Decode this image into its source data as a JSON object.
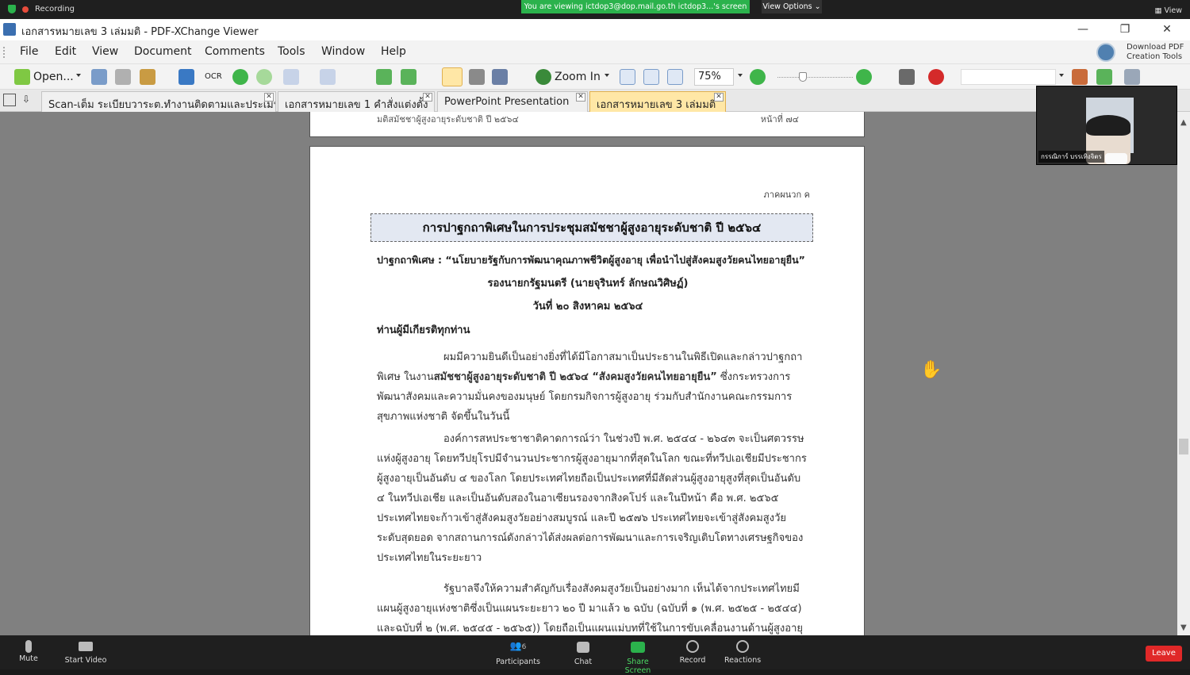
{
  "zoom": {
    "recording_label": "Recording",
    "viewing_banner": "You are viewing ictdop3@dop.mail.go.th ictdop3...'s screen",
    "view_options": "View Options ⌄",
    "view_right": "▦ View",
    "bottom": {
      "mute": "Mute",
      "start_video": "Start Video",
      "participants": "Participants",
      "participants_count": "6",
      "chat": "Chat",
      "share_screen": "Share Screen",
      "record": "Record",
      "reactions": "Reactions",
      "leave": "Leave"
    },
    "video_name": "กรรณิการ์ บรรเทิงจิตร",
    "colors": {
      "share_green": "#2bb24c",
      "leave_red": "#e02828"
    }
  },
  "window": {
    "title": "เอกสารหมายเลข 3 เล่มมติ - PDF-XChange Viewer",
    "menu": [
      "File",
      "Edit",
      "View",
      "Document",
      "Comments",
      "Tools",
      "Window",
      "Help"
    ],
    "download_line1": "Download PDF",
    "download_line2": "Creation Tools",
    "toolbar": {
      "open": "Open...",
      "zoom_in": "Zoom In",
      "zoom_value": "75%",
      "ocr": "OCR"
    },
    "tabs": [
      "Scan-เต็ม ระเบียบวาระต.ทำงานติดตามและประเมิน",
      "เอกสารหมายเลข 1 คำสั่งแต่งตั้ง",
      "PowerPoint Presentation",
      "เอกสารหมายเลข 3 เล่มมติ"
    ]
  },
  "document": {
    "prev_header_left": "มติสมัชชาผู้สูงอายุระดับชาติ ปี ๒๕๖๔",
    "prev_header_right": "หน้าที่ ๗๔",
    "appendix": "ภาคผนวก ค",
    "heading": "การปาฐกถาพิเศษในการประชุมสมัชชาผู้สูงอายุระดับชาติ ปี ๒๕๖๔",
    "speech_title": "ปาฐกถาพิเศษ : “นโยบายรัฐกับการพัฒนาคุณภาพชีวิตผู้สูงอายุ เพื่อนำไปสู่สังคมสูงวัยคนไทยอายุยืน”",
    "speaker": "รองนายกรัฐมนตรี (นายจุรินทร์ ลักษณวิศิษฏ์)",
    "date": "วันที่ ๒๐ สิงหาคม ๒๕๖๔",
    "salutation": "ท่านผู้มีเกียรติทุกท่าน",
    "para1_a": "ผมมีความยินดีเป็นอย่างยิ่งที่ได้มีโอกาสมาเป็นประธานในพิธีเปิดและกล่าวปาฐกถาพิเศษ ในงาน",
    "para1_bold": "สมัชชาผู้สูงอายุระดับชาติ ปี ๒๕๖๔ “สังคมสูงวัยคนไทยอายุยืน”",
    "para1_b": " ซึ่งกระทรวงการพัฒนาสังคมและความมั่นคงของมนุษย์ โดยกรมกิจการผู้สูงอายุ ร่วมกับสำนักงานคณะกรรมการสุขภาพแห่งชาติ จัดขึ้นในวันนี้",
    "para2": "องค์การสหประชาชาติคาดการณ์ว่า ในช่วงปี พ.ศ. ๒๕๔๔ - ๒๖๔๓ จะเป็นศตวรรษแห่งผู้สูงอายุ โดยทวีปยุโรปมีจำนวนประชากรผู้สูงอายุมากที่สุดในโลก ขณะที่ทวีปเอเชียมีประชากรผู้สูงอายุเป็นอันดับ ๔ ของโลก โดยประเทศไทยถือเป็นประเทศที่มีสัดส่วนผู้สูงอายุสูงที่สุดเป็นอันดับ ๔ ในทวีปเอเชีย และเป็นอันดับสองในอาเซียนรองจากสิงคโปร์ และในปีหน้า คือ พ.ศ. ๒๕๖๕ ประเทศไทยจะก้าวเข้าสู่สังคมสูงวัยอย่างสมบูรณ์ และปี ๒๕๗๖ ประเทศไทยจะเข้าสู่สังคมสูงวัยระดับสุดยอด จากสถานการณ์ดังกล่าวได้ส่งผลต่อการพัฒนาและการเจริญเติบโตทางเศรษฐกิจของประเทศไทยในระยะยาว",
    "para3": "รัฐบาลจึงให้ความสำคัญกับเรื่องสังคมสูงวัยเป็นอย่างมาก เห็นได้จากประเทศไทยมีแผนผู้สูงอายุแห่งชาติซึ่งเป็นแผนระยะยาว ๒๐ ปี มาแล้ว ๒ ฉบับ (ฉบับที่ ๑ (พ.ศ. ๒๕๒๕ - ๒๕๔๔) และฉบับที่ ๒ (พ.ศ. ๒๕๔๕ - ๒๕๖๕)) โดยถือเป็นแผนแม่บทที่ใช้ในการขับเคลื่อนงานด้านผู้สูงอายุ"
  }
}
